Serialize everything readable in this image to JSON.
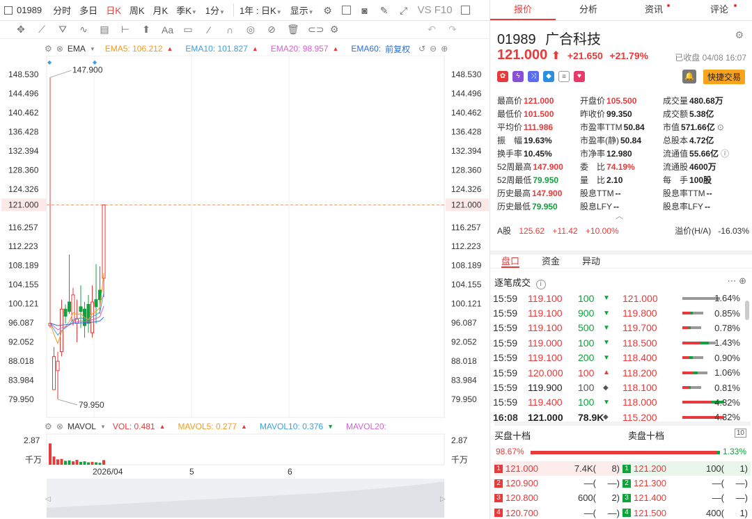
{
  "toolbar": {
    "symbol": "01989",
    "items": [
      "分时",
      "多日",
      "日K",
      "周K",
      "月K",
      "季K",
      "1分"
    ],
    "active": "日K",
    "range": "1年 : 日K",
    "display": "显示",
    "vs": "VS F10"
  },
  "ema": {
    "label": "EMA",
    "ema5": "EMA5: 106.212",
    "ema10": "EMA10: 101.827",
    "ema20": "EMA20: 98.957",
    "ema60": "EMA60:",
    "adjust": "前复权",
    "colors": {
      "ema5": "#f29b1e",
      "ema10": "#3aa0e0",
      "ema20": "#d85fd0",
      "ema60": "#2a6fd8"
    }
  },
  "chart": {
    "price_ticks": [
      "148.530",
      "144.496",
      "140.462",
      "136.428",
      "132.394",
      "128.360",
      "124.326",
      "121.000",
      "116.257",
      "112.223",
      "108.189",
      "104.155",
      "100.121",
      "96.087",
      "92.052",
      "88.018",
      "83.984",
      "79.950"
    ],
    "high_label": "147.900",
    "low_label": "79.950",
    "current_price": "121.000",
    "x_labels": [
      "2026/04",
      "5",
      "6"
    ],
    "vol_ticks": [
      "2.87",
      "千万"
    ]
  },
  "chart_data": {
    "type": "candlestick",
    "title": "",
    "ylim": [
      79.95,
      148.53
    ],
    "candles": [
      {
        "o": 95.5,
        "h": 147.9,
        "l": 95.0,
        "c": 96.0
      },
      {
        "o": 82.0,
        "h": 91.0,
        "l": 82.0,
        "c": 89.0
      },
      {
        "o": 86.0,
        "h": 90.0,
        "l": 79.95,
        "c": 88.0
      },
      {
        "o": 90.0,
        "h": 101.0,
        "l": 89.0,
        "c": 99.0
      },
      {
        "o": 99.0,
        "h": 100.0,
        "l": 96.0,
        "c": 97.5
      },
      {
        "o": 100.5,
        "h": 110.5,
        "l": 98.0,
        "c": 98.5
      },
      {
        "o": 96.5,
        "h": 103.5,
        "l": 95.5,
        "c": 102.0
      },
      {
        "o": 96.0,
        "h": 101.0,
        "l": 92.0,
        "c": 97.0
      },
      {
        "o": 99.5,
        "h": 104.0,
        "l": 95.0,
        "c": 98.5
      },
      {
        "o": 99.0,
        "h": 100.5,
        "l": 93.0,
        "c": 95.5
      },
      {
        "o": 100.0,
        "h": 102.0,
        "l": 94.0,
        "c": 96.0
      },
      {
        "o": 94.0,
        "h": 104.0,
        "l": 93.0,
        "c": 100.5
      },
      {
        "o": 101.0,
        "h": 108.5,
        "l": 96.0,
        "c": 99.5
      },
      {
        "o": 103.0,
        "h": 108.0,
        "l": 98.0,
        "c": 101.0
      },
      {
        "o": 105.5,
        "h": 121.0,
        "l": 101.5,
        "c": 121.0
      }
    ],
    "vol_ylim": [
      0,
      2.87
    ],
    "volumes": [
      2.2,
      0.85,
      0.55,
      0.6,
      0.4,
      0.45,
      0.35,
      0.5,
      0.3,
      0.35,
      0.25,
      0.3,
      0.25,
      0.2,
      0.48
    ]
  },
  "vol": {
    "label": "MAVOL",
    "vol": "VOL: 0.481",
    "mavol5": "MAVOL5: 0.277",
    "mavol10": "MAVOL10: 0.376",
    "mavol20": "MAVOL20:"
  },
  "right": {
    "tabs": [
      "报价",
      "分析",
      "资讯",
      "评论"
    ],
    "code": "01989",
    "name": "广合科技",
    "price": "121.000",
    "change": "+21.650",
    "pct": "+21.79%",
    "status": "已收盘 04/08 16:07",
    "fast_trade": "快捷交易",
    "stats": [
      [
        [
          "最高价",
          "121.000",
          "red"
        ],
        [
          "开盘价",
          "105.500",
          "red"
        ],
        [
          "成交量",
          "480.68万",
          "dark"
        ]
      ],
      [
        [
          "最低价",
          "101.500",
          "red"
        ],
        [
          "昨收价",
          "99.350",
          "dark"
        ],
        [
          "成交额",
          "5.38亿",
          "dark"
        ]
      ],
      [
        [
          "平均价",
          "111.986",
          "red"
        ],
        [
          "市盈率TTM",
          "50.84",
          "dark"
        ],
        [
          "市值",
          "571.66亿",
          "dark"
        ]
      ],
      [
        [
          "振　幅",
          "19.63%",
          "dark"
        ],
        [
          "市盈率(静)",
          "50.84",
          "dark"
        ],
        [
          "总股本",
          "4.72亿",
          "dark"
        ]
      ],
      [
        [
          "换手率",
          "10.45%",
          "dark"
        ],
        [
          "市净率",
          "12.980",
          "dark"
        ],
        [
          "流通值",
          "55.66亿",
          "dark"
        ]
      ],
      [
        [
          "52周最高",
          "147.900",
          "red"
        ],
        [
          "委　比",
          "74.19%",
          "red"
        ],
        [
          "流通股",
          "4600万",
          "dark"
        ]
      ],
      [
        [
          "52周最低",
          "79.950",
          "green"
        ],
        [
          "量　比",
          "2.10",
          "dark"
        ],
        [
          "每　手",
          "100股",
          "dark"
        ]
      ],
      [
        [
          "历史最高",
          "147.900",
          "red"
        ],
        [
          "股息TTM",
          "--",
          "dark"
        ],
        [
          "股息率TTM",
          "--",
          "dark"
        ]
      ],
      [
        [
          "历史最低",
          "79.950",
          "green"
        ],
        [
          "股息LFY",
          "--",
          "dark"
        ],
        [
          "股息率LFY",
          "--",
          "dark"
        ]
      ]
    ],
    "a_share": {
      "label": "A股",
      "price": "125.62",
      "chg": "+11.42",
      "pct": "+10.00%",
      "premium_label": "溢价(H/A)",
      "premium": "-16.03%"
    },
    "sub_tabs": [
      "盘口",
      "资金",
      "异动"
    ],
    "trades_title": "逐笔成交",
    "trades": [
      {
        "t": "15:59",
        "p": "119.100",
        "q": "100",
        "d": "down"
      },
      {
        "t": "15:59",
        "p": "119.100",
        "q": "900",
        "d": "down"
      },
      {
        "t": "15:59",
        "p": "119.100",
        "q": "500",
        "d": "down"
      },
      {
        "t": "15:59",
        "p": "119.000",
        "q": "100",
        "d": "down"
      },
      {
        "t": "15:59",
        "p": "119.100",
        "q": "200",
        "d": "down"
      },
      {
        "t": "15:59",
        "p": "120.000",
        "q": "100",
        "d": "up"
      },
      {
        "t": "15:59",
        "p": "119.900",
        "q": "100",
        "d": "neutral"
      },
      {
        "t": "15:59",
        "p": "119.400",
        "q": "100",
        "d": "down"
      },
      {
        "t": "16:08",
        "p": "121.000",
        "q": "78.9K",
        "d": "neutral"
      }
    ],
    "price_dist": [
      {
        "p": "121.000",
        "pct": "1.64%",
        "red": 0.0,
        "green": 0.0,
        "fill": 0.9
      },
      {
        "p": "119.800",
        "pct": "0.85%",
        "red": 0.4,
        "green": 0.1,
        "fill": 0.5
      },
      {
        "p": "119.700",
        "pct": "0.78%",
        "red": 0.35,
        "green": 0.1,
        "fill": 0.45
      },
      {
        "p": "118.500",
        "pct": "1.43%",
        "red": 0.55,
        "green": 0.25,
        "fill": 0.8
      },
      {
        "p": "118.400",
        "pct": "0.90%",
        "red": 0.3,
        "green": 0.2,
        "fill": 0.5
      },
      {
        "p": "118.200",
        "pct": "1.06%",
        "red": 0.45,
        "green": 0.15,
        "fill": 0.6
      },
      {
        "p": "118.100",
        "pct": "0.81%",
        "red": 0.35,
        "green": 0.1,
        "fill": 0.45
      },
      {
        "p": "118.000",
        "pct": "4.32%",
        "red": 0.7,
        "green": 0.3,
        "fill": 1.0
      },
      {
        "p": "115.200",
        "pct": "4.32%",
        "red": 1.0,
        "green": 0.0,
        "fill": 1.0
      }
    ],
    "book_buy_title": "买盘十档",
    "book_sell_title": "卖盘十档",
    "book_buy_pct": "98.67%",
    "book_sell_pct": "1.33%",
    "book": [
      {
        "bi": "1",
        "bp": "121.000",
        "bv": "7.4K(",
        "bn": "8)",
        "si": "1",
        "sp": "121.200",
        "sv": "100(",
        "sn": "1)"
      },
      {
        "bi": "2",
        "bp": "120.900",
        "bv": "—(",
        "bn": "—)",
        "si": "2",
        "sp": "121.300",
        "sv": "—(",
        "sn": "—)"
      },
      {
        "bi": "3",
        "bp": "120.800",
        "bv": "600(",
        "bn": "2)",
        "si": "3",
        "sp": "121.400",
        "sv": "—(",
        "sn": "—)"
      },
      {
        "bi": "4",
        "bp": "120.700",
        "bv": "—(",
        "bn": "—)",
        "si": "4",
        "sp": "121.500",
        "sv": "400(",
        "sn": "1)"
      }
    ]
  }
}
